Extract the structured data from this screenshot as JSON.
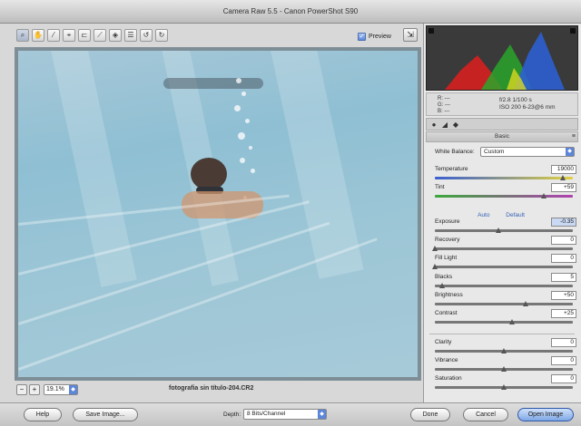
{
  "window": {
    "title": "Camera Raw 5.5  -  Canon PowerShot S90"
  },
  "toolbar": {
    "tools": [
      {
        "name": "zoom-tool",
        "glyph": "⌕"
      },
      {
        "name": "hand-tool",
        "glyph": "✋"
      },
      {
        "name": "white-balance-tool",
        "glyph": "⁄"
      },
      {
        "name": "color-sampler-tool",
        "glyph": "⌖"
      },
      {
        "name": "crop-tool",
        "glyph": "⊏"
      },
      {
        "name": "straighten-tool",
        "glyph": "⟋"
      },
      {
        "name": "retouch-tool",
        "glyph": "◈"
      },
      {
        "name": "preferences-tool",
        "glyph": "☰"
      },
      {
        "name": "rotate-left-tool",
        "glyph": "↺"
      },
      {
        "name": "rotate-right-tool",
        "glyph": "↻"
      }
    ],
    "preview_label": "Preview",
    "preview_checked": true
  },
  "status": {
    "zoom": "19.1%",
    "filename": "fotografia sin título-204.CR2"
  },
  "histogram": {
    "colors": [
      "#d62020",
      "#2aa52a",
      "#2d5fd0",
      "#d8d820"
    ]
  },
  "info": {
    "rgb": [
      "R: ---",
      "G: ---",
      "B: ---"
    ],
    "exif_line1": "f/2.8   1/100 s",
    "exif_line2": "ISO 200   6-23@6 mm"
  },
  "panel": {
    "section_title": "Basic",
    "white_balance": {
      "label": "White Balance:",
      "value": "Custom"
    },
    "auto_label": "Auto",
    "default_label": "Default",
    "controls": [
      {
        "id": "temperature",
        "label": "Temperature",
        "value": "19000",
        "pos": 0.93,
        "selected": false
      },
      {
        "id": "tint",
        "label": "Tint",
        "value": "+59",
        "pos": 0.79,
        "selected": false
      },
      {
        "id": "exposure",
        "label": "Exposure",
        "value": "-0.35",
        "pos": 0.46,
        "selected": true
      },
      {
        "id": "recovery",
        "label": "Recovery",
        "value": "0",
        "pos": 0.0,
        "selected": false
      },
      {
        "id": "fill-light",
        "label": "Fill Light",
        "value": "0",
        "pos": 0.0,
        "selected": false
      },
      {
        "id": "blacks",
        "label": "Blacks",
        "value": "5",
        "pos": 0.05,
        "selected": false
      },
      {
        "id": "brightness",
        "label": "Brightness",
        "value": "+50",
        "pos": 0.66,
        "selected": false
      },
      {
        "id": "contrast",
        "label": "Contrast",
        "value": "+25",
        "pos": 0.56,
        "selected": false
      },
      {
        "id": "clarity",
        "label": "Clarity",
        "value": "0",
        "pos": 0.5,
        "selected": false
      },
      {
        "id": "vibrance",
        "label": "Vibrance",
        "value": "0",
        "pos": 0.5,
        "selected": false
      },
      {
        "id": "saturation",
        "label": "Saturation",
        "value": "0",
        "pos": 0.5,
        "selected": false
      }
    ]
  },
  "footer": {
    "help": "Help",
    "save_image": "Save Image...",
    "depth_label": "Depth:",
    "depth_value": "8 Bits/Channel",
    "done": "Done",
    "cancel": "Cancel",
    "open_image": "Open Image"
  }
}
